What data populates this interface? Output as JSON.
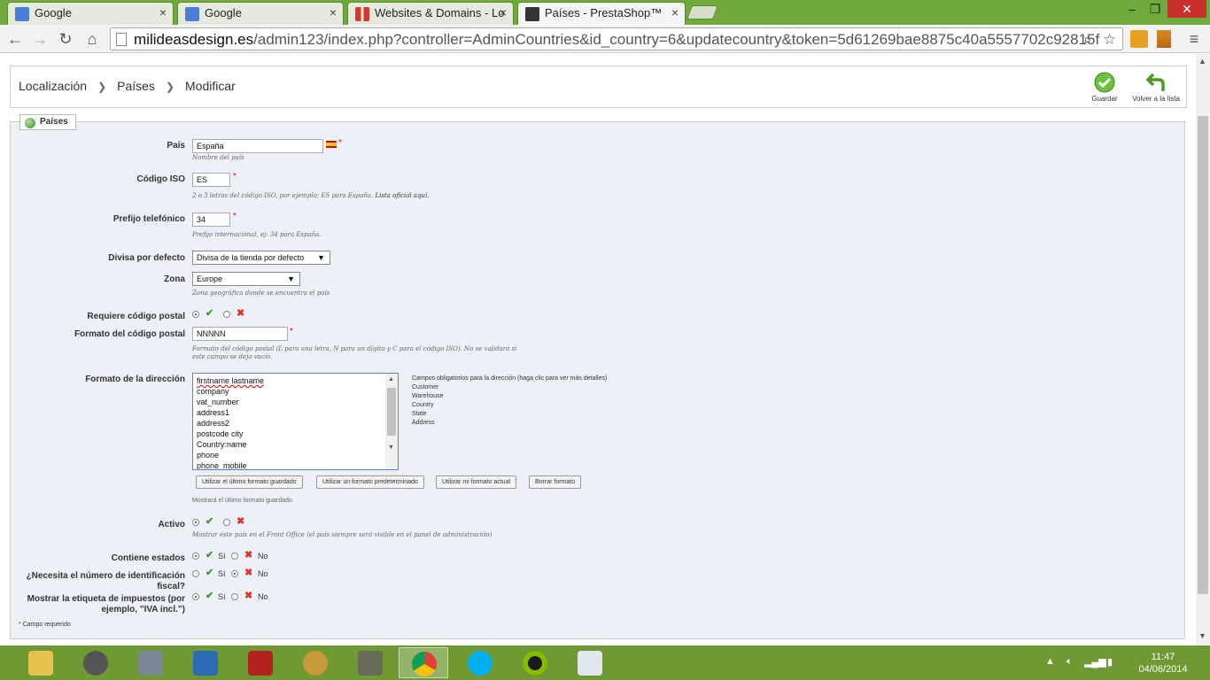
{
  "browser": {
    "tabs": [
      {
        "title": "Google",
        "active": false
      },
      {
        "title": "Google",
        "active": false
      },
      {
        "title": "Websites & Domains - Lo",
        "active": false
      },
      {
        "title": "Países - PrestaShop™",
        "active": true
      }
    ],
    "url_host": "milideasdesign.es",
    "url_path": "/admin123/index.php?controller=AdminCountries&id_country=6&updatecountry&token=5d61269bae8875c40a5557702c92815f"
  },
  "header": {
    "breadcrumb": [
      "Localización",
      "Países",
      "Modificar"
    ],
    "save_label": "Guardar",
    "back_label": "Volver a la lista"
  },
  "form": {
    "legend": "Países",
    "country": {
      "label": "País",
      "value": "España",
      "hint": "Nombre del país"
    },
    "iso": {
      "label": "Código ISO",
      "value": "ES",
      "hint": "2 o 3 letras del código ISO, por ejemplo; ES para España.",
      "link": "Lista oficial aquí",
      "hint_end": "."
    },
    "phone_prefix": {
      "label": "Prefijo telefónico",
      "value": "34",
      "hint": "Prefijo internacional, ej: 34 para España."
    },
    "currency": {
      "label": "Divisa por defecto",
      "value": "Divisa de la tienda por defecto"
    },
    "zone": {
      "label": "Zona",
      "value": "Europe",
      "hint": "Zona geográfica donde se encuentra el país"
    },
    "needs_zip": {
      "label": "Requiere código postal",
      "selected": "yes"
    },
    "zip_format": {
      "label": "Formato del código postal",
      "value": "NNNNN",
      "hint": "Formato del código postal (L para una letra, N para un dígito y C para el código ISO). No se validará si este campo se deja vacío."
    },
    "address_format": {
      "label": "Formato de la dirección",
      "lines": [
        "firstname lastname",
        "company",
        "vat_number",
        "address1",
        "address2",
        "postcode city",
        "Country:name",
        "phone",
        "phone_mobile"
      ],
      "required_title": "Campos obligatorios para la dirección (haga clic para ver más detalles)",
      "required_fields": [
        "Customer",
        "Warehouse",
        "Country",
        "State",
        "Address"
      ],
      "buttons": [
        "Utilizar el último formato guardado",
        "Utilizar un formato predeterminado",
        "Utilizar mi formato actual",
        "Borrar formato"
      ],
      "hint": "Mostrará el último formato guardado"
    },
    "active": {
      "label": "Activo",
      "selected": "yes",
      "hint": "Mostrar este país en el Front Office (el país siempre será visible en el panel de administración)"
    },
    "contains_states": {
      "label": "Contiene estados",
      "selected": "yes",
      "yes": "Sí",
      "no": "No"
    },
    "need_vat": {
      "label": "¿Necesita el número de identificación fiscal?",
      "selected": "no",
      "yes": "Sí",
      "no": "No"
    },
    "display_tax": {
      "label": "Mostrar la etiqueta de impuestos (por ejemplo, \"IVA incl.\")",
      "selected": "yes",
      "yes": "Sí",
      "no": "No"
    },
    "required_note": "Campo requerido",
    "required_star": "*"
  },
  "taskbar": {
    "time": "11:47",
    "date": "04/06/2014"
  }
}
